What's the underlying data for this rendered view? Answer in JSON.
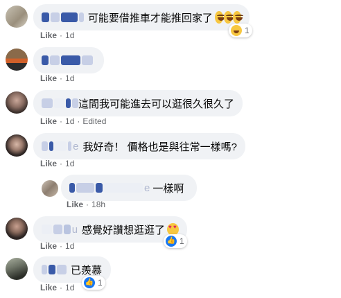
{
  "likeLabel": "Like",
  "comments": [
    {
      "text": "可能要借推車才能推回家了",
      "time": "1d",
      "reactCount": "1"
    },
    {
      "text": "",
      "time": "1d"
    },
    {
      "text": "這間我可能進去可以逛很久很久了",
      "time": "1d",
      "edited": "Edited"
    },
    {
      "text": "我好奇！ 價格也是與往常一樣嗎?",
      "time": "1d"
    },
    {
      "text": "一樣啊",
      "time": "18h"
    },
    {
      "text": "感覺好讚想逛逛了",
      "time": "1d",
      "reactCount": "1"
    },
    {
      "text": "已羨慕",
      "time": "1d",
      "reactCount": "1"
    }
  ],
  "blurredNameColors": [
    "#3a5aa8",
    "#b9c4e0"
  ],
  "reactionIcons": [
    "laugh-emoji",
    "heart-eyes-emoji",
    "like-thumb-icon",
    "haha-icon"
  ]
}
